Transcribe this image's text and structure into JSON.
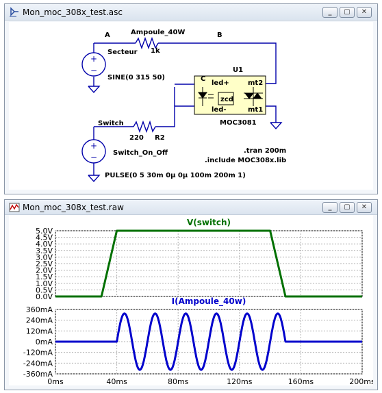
{
  "schematic_window": {
    "title": "Mon_moc_308x_test.asc",
    "icon": "schematic-icon",
    "buttons": [
      "minimize-icon",
      "restore-icon",
      "close-icon"
    ],
    "nets": {
      "a": "A",
      "b": "B",
      "c": "C"
    },
    "components": {
      "v1_name": "Secteur",
      "v1_value": "SINE(0 315 50)",
      "r1_name": "Ampoule_40W",
      "r1_value": "1k",
      "r2_name": "R2",
      "r2_value": "220",
      "v2_name": "Switch_On_Off",
      "v2_value": "PULSE(0 5 30m 0µ 0µ 100m 200m 1)",
      "switch_label": "Switch",
      "u1_name": "U1",
      "u1_part": "MOC3081",
      "pin_led_plus": "led+",
      "pin_led_minus": "led-",
      "pin_mt2": "mt2",
      "pin_mt1": "mt1",
      "zcd": "zcd"
    },
    "directives": [
      ".tran 200m",
      ".include MOC308x.lib"
    ],
    "colors": {
      "wire": "#0000aa",
      "text": "#000000",
      "u1_fill": "#ffffc8"
    }
  },
  "waveform_window": {
    "title": "Mon_moc_308x_test.raw",
    "icon": "waveform-icon",
    "buttons": [
      "minimize-icon",
      "restore-icon",
      "close-icon"
    ]
  },
  "chart_data": [
    {
      "type": "line",
      "title": "V(switch)",
      "x_unit": "ms",
      "xlim": [
        0,
        200
      ],
      "ylim": [
        0,
        5
      ],
      "yticks": [
        "0.0V",
        "0.5V",
        "1.0V",
        "1.5V",
        "2.0V",
        "2.5V",
        "3.0V",
        "3.5V",
        "4.0V",
        "4.5V",
        "5.0V"
      ],
      "ytick_values": [
        0,
        0.5,
        1,
        1.5,
        2,
        2.5,
        3,
        3.5,
        4,
        4.5,
        5
      ],
      "grid": true,
      "color": "#007000",
      "x": [
        0,
        30,
        40,
        140,
        150,
        200
      ],
      "y": [
        0,
        0,
        5,
        5,
        0,
        0
      ]
    },
    {
      "type": "line",
      "title": "I(Ampoule_40w)",
      "x_unit": "ms",
      "xlim": [
        0,
        200
      ],
      "ylim": [
        -360,
        360
      ],
      "yticks": [
        "-360mA",
        "-240mA",
        "-120mA",
        "0mA",
        "120mA",
        "240mA",
        "360mA"
      ],
      "ytick_values": [
        -360,
        -240,
        -120,
        0,
        120,
        240,
        360
      ],
      "xticks": [
        "0ms",
        "40ms",
        "80ms",
        "120ms",
        "160ms",
        "200ms"
      ],
      "xtick_values": [
        0,
        40,
        80,
        120,
        160,
        200
      ],
      "grid": true,
      "color": "#0000cc",
      "amplitude_mA": 315,
      "frequency_hz": 50,
      "on_from_ms": 40,
      "on_to_ms": 150,
      "off_value": 0
    }
  ]
}
